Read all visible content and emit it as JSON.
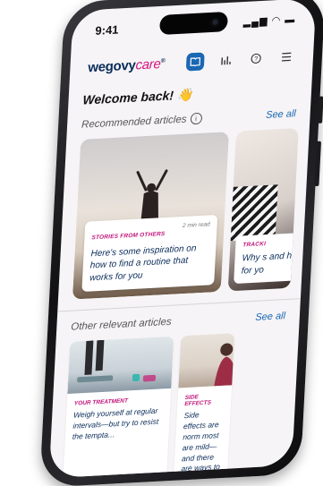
{
  "status": {
    "time": "9:41"
  },
  "header": {
    "logo_main": "wegovy",
    "logo_accent": "care",
    "logo_reg": "®"
  },
  "nav_icons": [
    "book-icon",
    "bar-chart-icon",
    "help-icon",
    "menu-icon"
  ],
  "welcome": {
    "text": "Welcome back! 👋"
  },
  "recommended": {
    "title": "Recommended articles",
    "see_all": "See all",
    "cards": [
      {
        "category": "STORIES FROM OTHERS",
        "read_time": "2 min read",
        "title": "Here's some inspiration on how to find a routine that works for you"
      },
      {
        "category": "TRACKI",
        "title": "Why s and h for yo"
      }
    ]
  },
  "other": {
    "title": "Other relevant articles",
    "see_all": "See all",
    "cards": [
      {
        "category": "YOUR TREATMENT",
        "text": "Weigh yourself at regular intervals—but try to resist the tempta..."
      },
      {
        "category": "SIDE EFFECTS",
        "text": "Side effects are norm most are mild—and there are ways to han"
      }
    ]
  },
  "colors": {
    "accent_blue": "#1a67b3",
    "brand_magenta": "#d3157f",
    "navy": "#0a2c5a"
  }
}
